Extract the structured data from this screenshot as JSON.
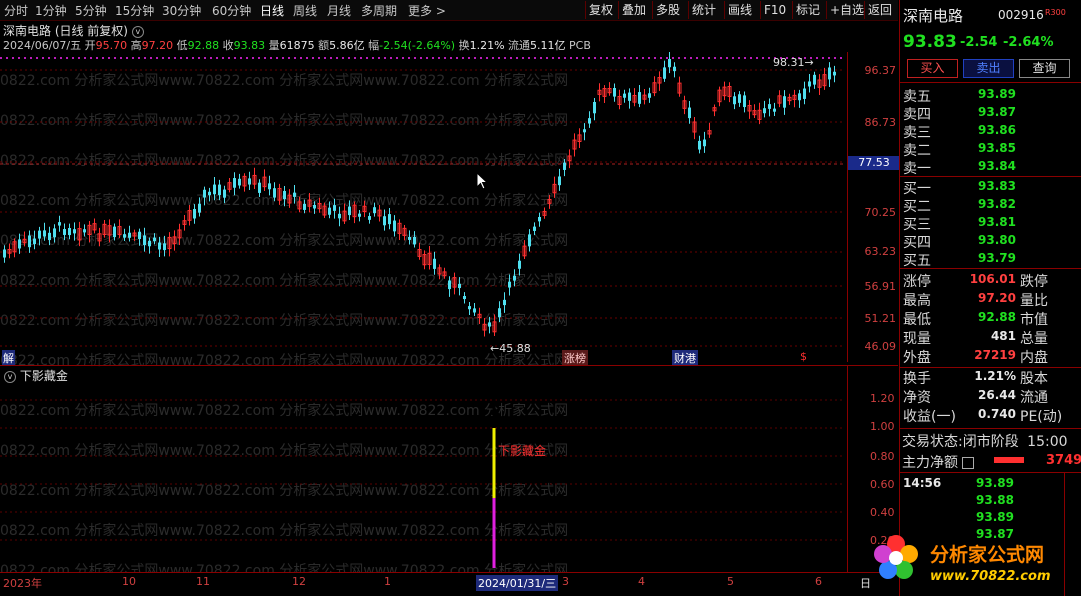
{
  "toolbar": {
    "periods": [
      "分时",
      "1分钟",
      "5分钟",
      "15分钟",
      "30分钟",
      "60分钟",
      "日线",
      "周线",
      "月线",
      "多周期",
      "更多 >"
    ],
    "active_period": "日线",
    "buttons": [
      "复权",
      "叠加",
      "多股",
      "统计",
      "画线",
      "F10",
      "标记",
      "+自选",
      "返回"
    ]
  },
  "chart_header": {
    "title": "深南电路 (日线 前复权)",
    "date": "2024/06/07/五",
    "open_label": "开",
    "open": "95.70",
    "high_label": "高",
    "high": "97.20",
    "low_label": "低",
    "low": "92.88",
    "close_label": "收",
    "close": "93.83",
    "vol_label": "量",
    "vol": "61875",
    "amount_label": "额",
    "amount": "5.86亿",
    "change_label": "幅",
    "change": "-2.54(-2.64%)",
    "turnover_label": "换",
    "turnover": "1.21%",
    "float_label": "流通",
    "float": "5.11亿",
    "sector": "PCB"
  },
  "price_axis": [
    "96.37",
    "86.73",
    "77.53",
    "70.25",
    "63.23",
    "56.91",
    "51.21",
    "46.09"
  ],
  "current_price_tag": "77.53",
  "annotations": {
    "high_mark": "98.31",
    "low_mark": "45.88"
  },
  "event_tags": {
    "left": "解",
    "mid1": "涨榜",
    "mid2": "财港",
    "right": "$"
  },
  "indicator": {
    "name": "下影藏金",
    "signal_label": "下影藏金",
    "axis": [
      "1.20",
      "1.00",
      "0.80",
      "0.60",
      "0.40",
      "0.20"
    ],
    "signal_value": 1.0
  },
  "date_axis": {
    "labels": [
      "2023年",
      "10",
      "11",
      "12",
      "1",
      "2024/01/31/三",
      "3",
      "4",
      "5",
      "6"
    ],
    "corner": "日"
  },
  "watermark": "0822.com 分析家公式网www.70822.com 分析家公式网www.70822.com 分析家公式网",
  "logo": {
    "name": "分析家公式网",
    "url": "www.70822.com"
  },
  "quote_panel": {
    "name": "深南电路",
    "code": "002916",
    "badge": "R300",
    "price": "93.83",
    "change": "-2.54",
    "change_pct": "-2.64%",
    "buy_btn": "买入",
    "sell_btn": "卖出",
    "query_btn": "查询",
    "asks": [
      {
        "label": "卖五",
        "price": "93.89"
      },
      {
        "label": "卖四",
        "price": "93.87"
      },
      {
        "label": "卖三",
        "price": "93.86"
      },
      {
        "label": "卖二",
        "price": "93.85"
      },
      {
        "label": "卖一",
        "price": "93.84"
      }
    ],
    "bids": [
      {
        "label": "买一",
        "price": "93.83"
      },
      {
        "label": "买二",
        "price": "93.82"
      },
      {
        "label": "买三",
        "price": "93.81"
      },
      {
        "label": "买四",
        "price": "93.80"
      },
      {
        "label": "买五",
        "price": "93.79"
      }
    ],
    "stats": [
      {
        "l": "涨停",
        "v": "106.01",
        "r": "跌停"
      },
      {
        "l": "最高",
        "v": "97.20",
        "r": "量比"
      },
      {
        "l": "最低",
        "v": "92.88",
        "r": "市值"
      },
      {
        "l": "现量",
        "v": "481",
        "r": "总量"
      },
      {
        "l": "外盘",
        "v": "27219",
        "r": "内盘"
      }
    ],
    "stats2": [
      {
        "l": "换手",
        "v": "1.21%",
        "r": "股本"
      },
      {
        "l": "净资",
        "v": "26.44",
        "r": "流通"
      },
      {
        "l": "收益(一)",
        "v": "0.740",
        "r": "PE(动)"
      }
    ],
    "trade_status_label": "交易状态:",
    "trade_status": "闭市阶段",
    "trade_time": "15:00",
    "mainflow_label": "主力净额",
    "mainflow_value": "3749",
    "ticks": [
      {
        "time": "14:56",
        "price": "93.89"
      },
      {
        "time": "",
        "price": "93.88"
      },
      {
        "time": "",
        "price": "93.89"
      },
      {
        "time": "",
        "price": "93.87"
      }
    ]
  }
}
